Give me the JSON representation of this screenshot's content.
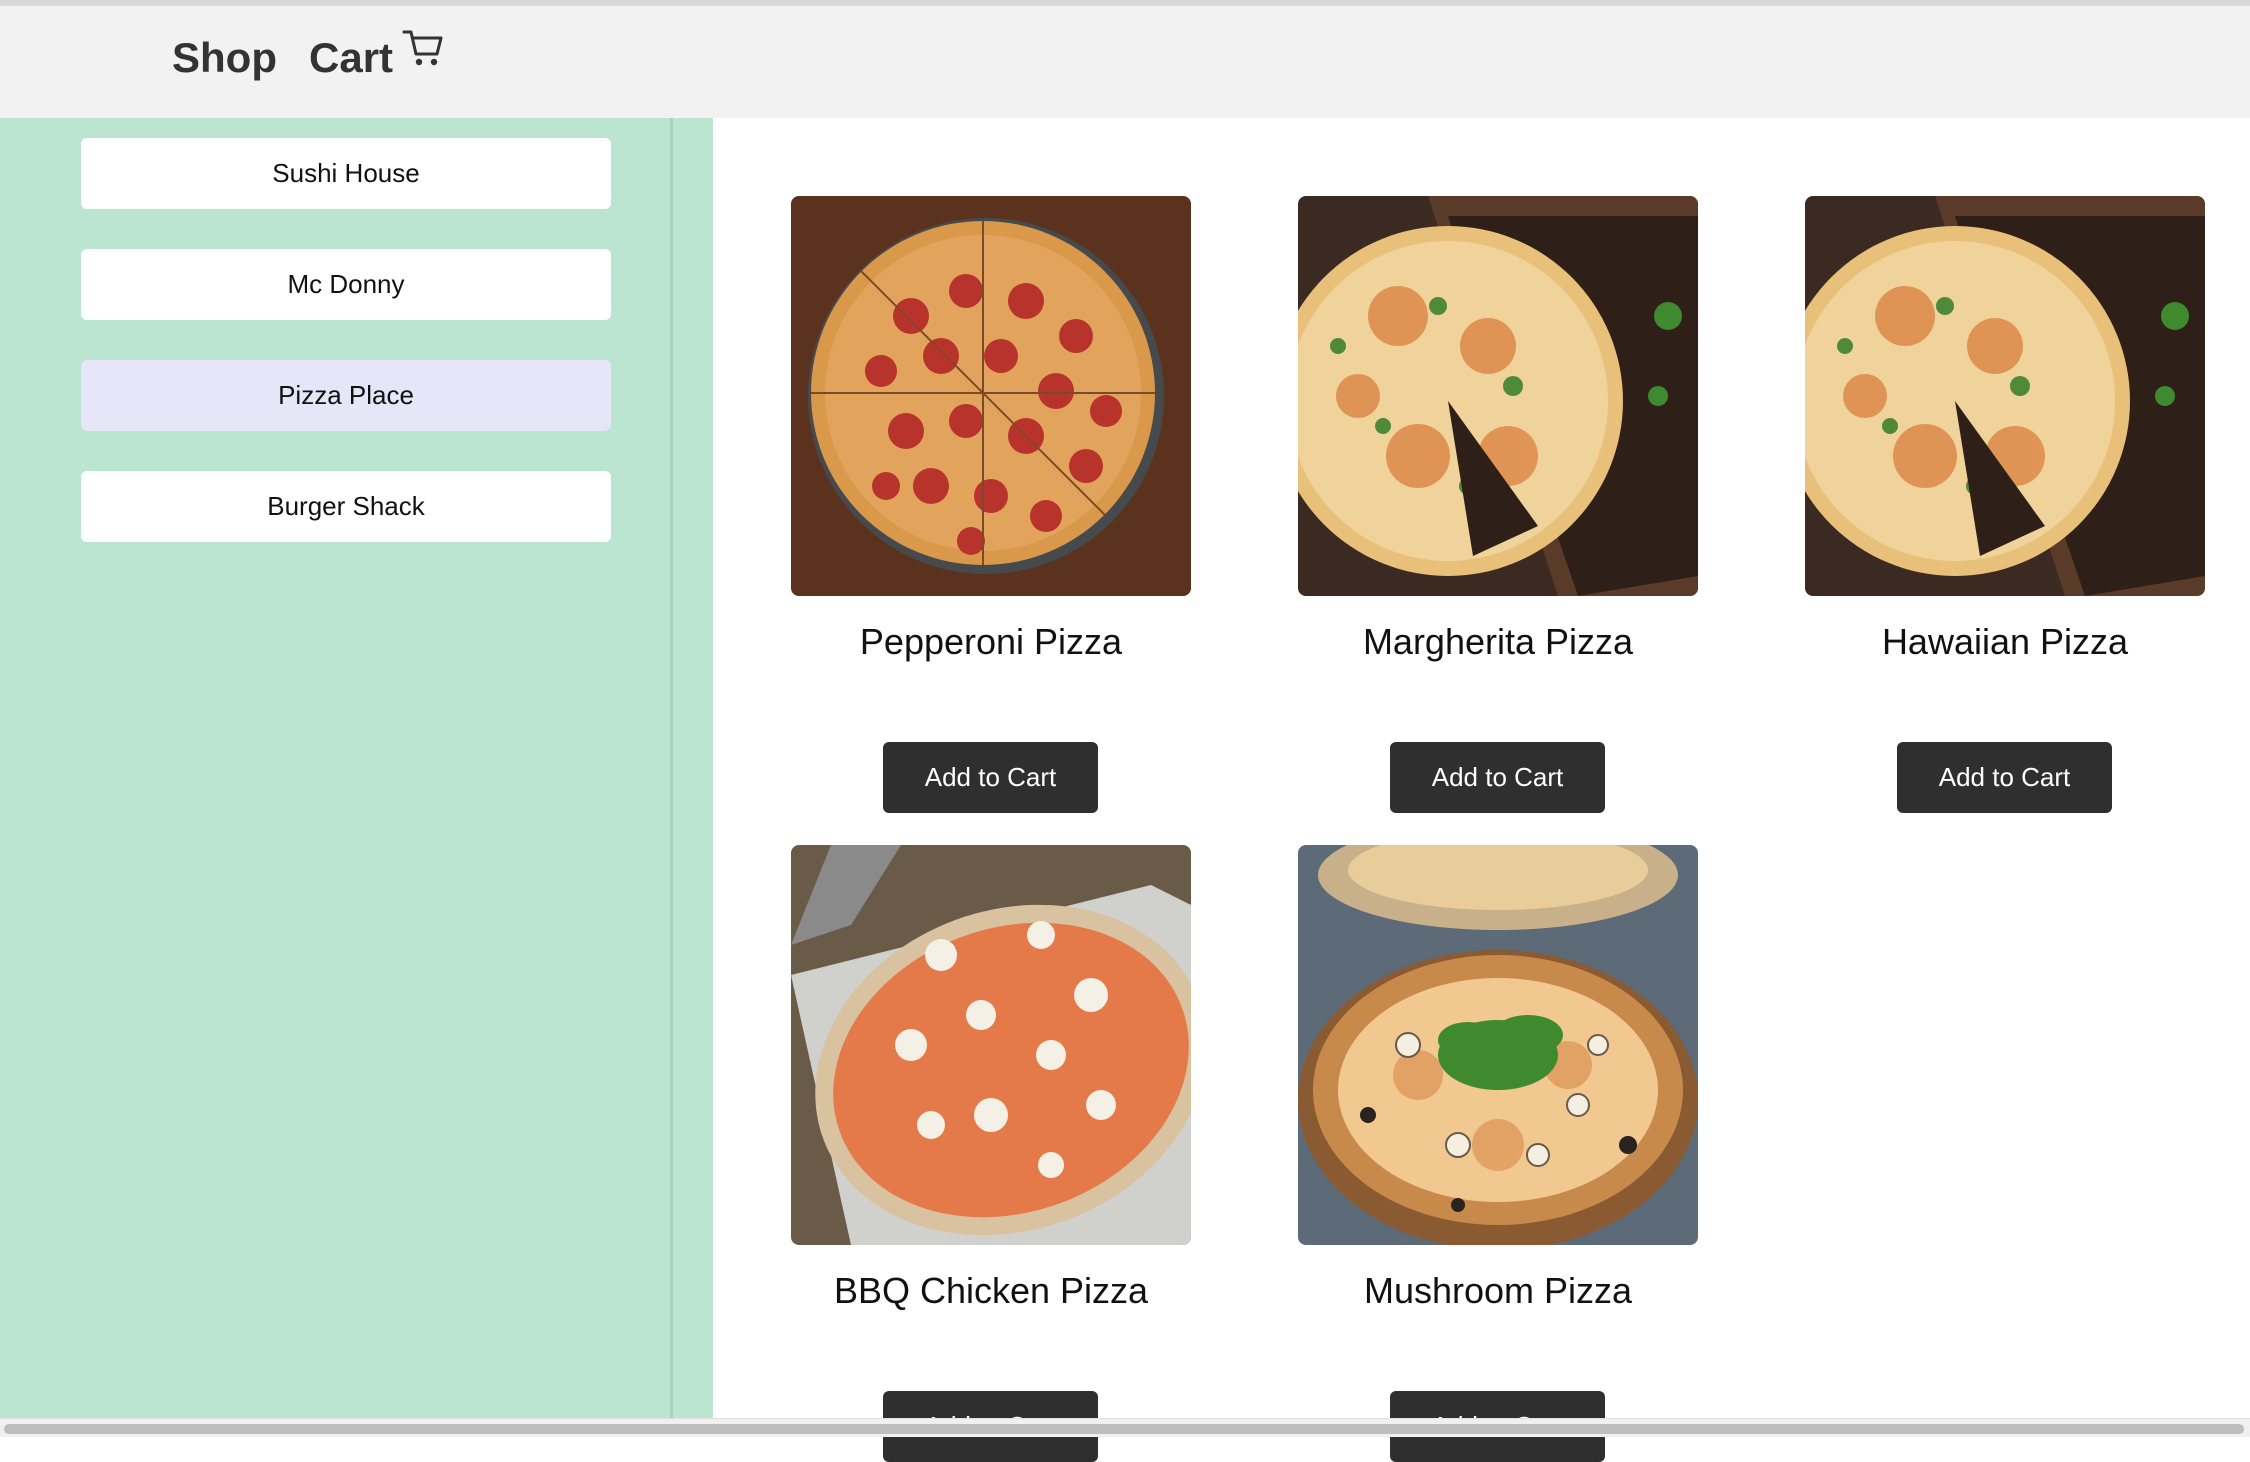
{
  "header": {
    "shop_label": "Shop",
    "cart_label": "Cart",
    "cart_icon": "shopping-cart-icon"
  },
  "sidebar": {
    "restaurants": [
      {
        "label": "Sushi House",
        "selected": false
      },
      {
        "label": "Mc Donny",
        "selected": false
      },
      {
        "label": "Pizza Place",
        "selected": true
      },
      {
        "label": "Burger Shack",
        "selected": false
      }
    ]
  },
  "products": [
    {
      "name": "Pepperoni Pizza",
      "button": "Add to Cart",
      "image": "pepperoni-pizza-photo"
    },
    {
      "name": "Margherita Pizza",
      "button": "Add to Cart",
      "image": "pizza-on-board-photo"
    },
    {
      "name": "Hawaiian Pizza",
      "button": "Add to Cart",
      "image": "pizza-on-board-photo"
    },
    {
      "name": "BBQ Chicken Pizza",
      "button": "Add to Cart",
      "image": "pizza-on-peel-photo"
    },
    {
      "name": "Mushroom Pizza",
      "button": "Add to Cart",
      "image": "mushroom-arugula-pizza-photo"
    }
  ],
  "colors": {
    "sidebar_bg": "#bbe5d1",
    "selected_item_bg": "#e6e6f8",
    "button_bg": "#2f2f2f",
    "header_bg": "#f2f2f2"
  }
}
